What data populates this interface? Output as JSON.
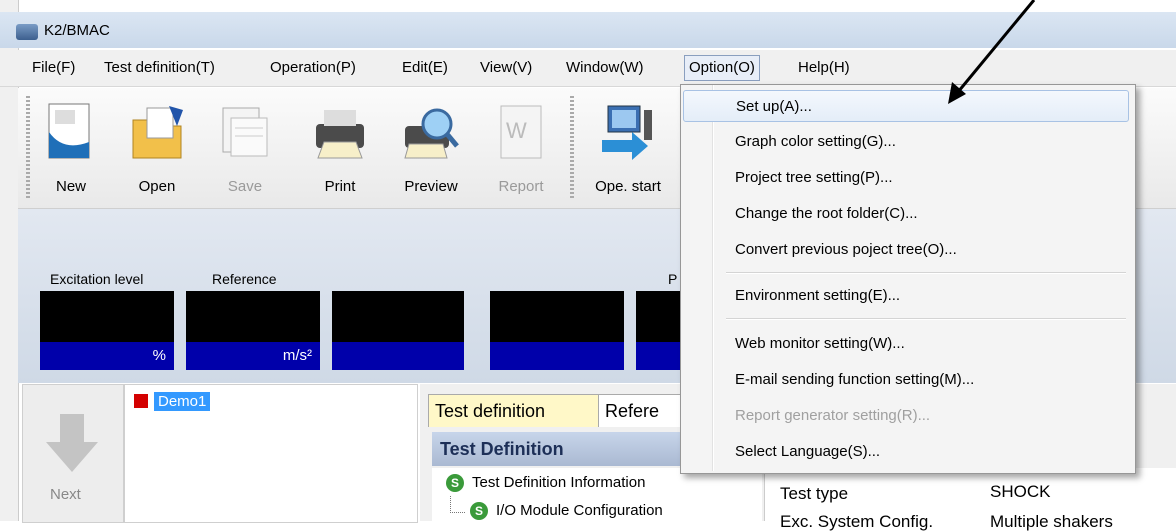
{
  "window": {
    "title": "K2/BMAC"
  },
  "menubar": {
    "items": [
      {
        "label": "File(F)"
      },
      {
        "label": "Test definition(T)"
      },
      {
        "label": "Operation(P)"
      },
      {
        "label": "Edit(E)"
      },
      {
        "label": "View(V)"
      },
      {
        "label": "Window(W)"
      },
      {
        "label": "Option(O)"
      },
      {
        "label": "Help(H)"
      }
    ]
  },
  "toolbar": {
    "buttons": [
      {
        "label": "New",
        "icon": "new-document-icon",
        "enabled": true
      },
      {
        "label": "Open",
        "icon": "folder-open-icon",
        "enabled": true
      },
      {
        "label": "Save",
        "icon": "save-icon",
        "enabled": false
      },
      {
        "label": "Print",
        "icon": "printer-icon",
        "enabled": true
      },
      {
        "label": "Preview",
        "icon": "print-preview-icon",
        "enabled": true
      },
      {
        "label": "Report",
        "icon": "word-report-icon",
        "enabled": false
      },
      {
        "label": "Ope. start",
        "icon": "operation-start-icon",
        "enabled": true
      }
    ]
  },
  "meters": {
    "captions": [
      "Excitation level",
      "Reference",
      "P"
    ],
    "units": [
      "%",
      "m/s²"
    ]
  },
  "navigation": {
    "next_label": "Next"
  },
  "project_tree": {
    "project_name": "Demo1"
  },
  "tabs": [
    {
      "label": "Test definition",
      "active": true
    },
    {
      "label": "Refere",
      "active": false
    }
  ],
  "test_definition": {
    "header": "Test Definition",
    "items": [
      {
        "label": "Test Definition Information",
        "badge": "S"
      },
      {
        "label": "I/O Module Configuration",
        "badge": "S"
      }
    ]
  },
  "info": {
    "rows": [
      {
        "key": "Test type",
        "value": "SHOCK"
      },
      {
        "key": "Exc. System Config.",
        "value": "Multiple shakers"
      }
    ]
  },
  "option_menu": {
    "items": [
      {
        "label": "Set up(A)...",
        "enabled": true,
        "highlighted": true
      },
      {
        "label": "Graph color setting(G)...",
        "enabled": true
      },
      {
        "label": "Project tree setting(P)...",
        "enabled": true
      },
      {
        "label": "Change the root folder(C)...",
        "enabled": true
      },
      {
        "label": "Convert previous poject tree(O)...",
        "enabled": true
      },
      {
        "label": "Environment setting(E)...",
        "enabled": true
      },
      {
        "label": "Web monitor setting(W)...",
        "enabled": true
      },
      {
        "label": "E-mail sending function setting(M)...",
        "enabled": true
      },
      {
        "label": "Report generator setting(R)...",
        "enabled": false
      },
      {
        "label": "Select Language(S)...",
        "enabled": true
      }
    ]
  },
  "colors": {
    "meter_value_bg": "#0000aa",
    "selection": "#3399ff",
    "active_tab": "#fff8c8"
  }
}
